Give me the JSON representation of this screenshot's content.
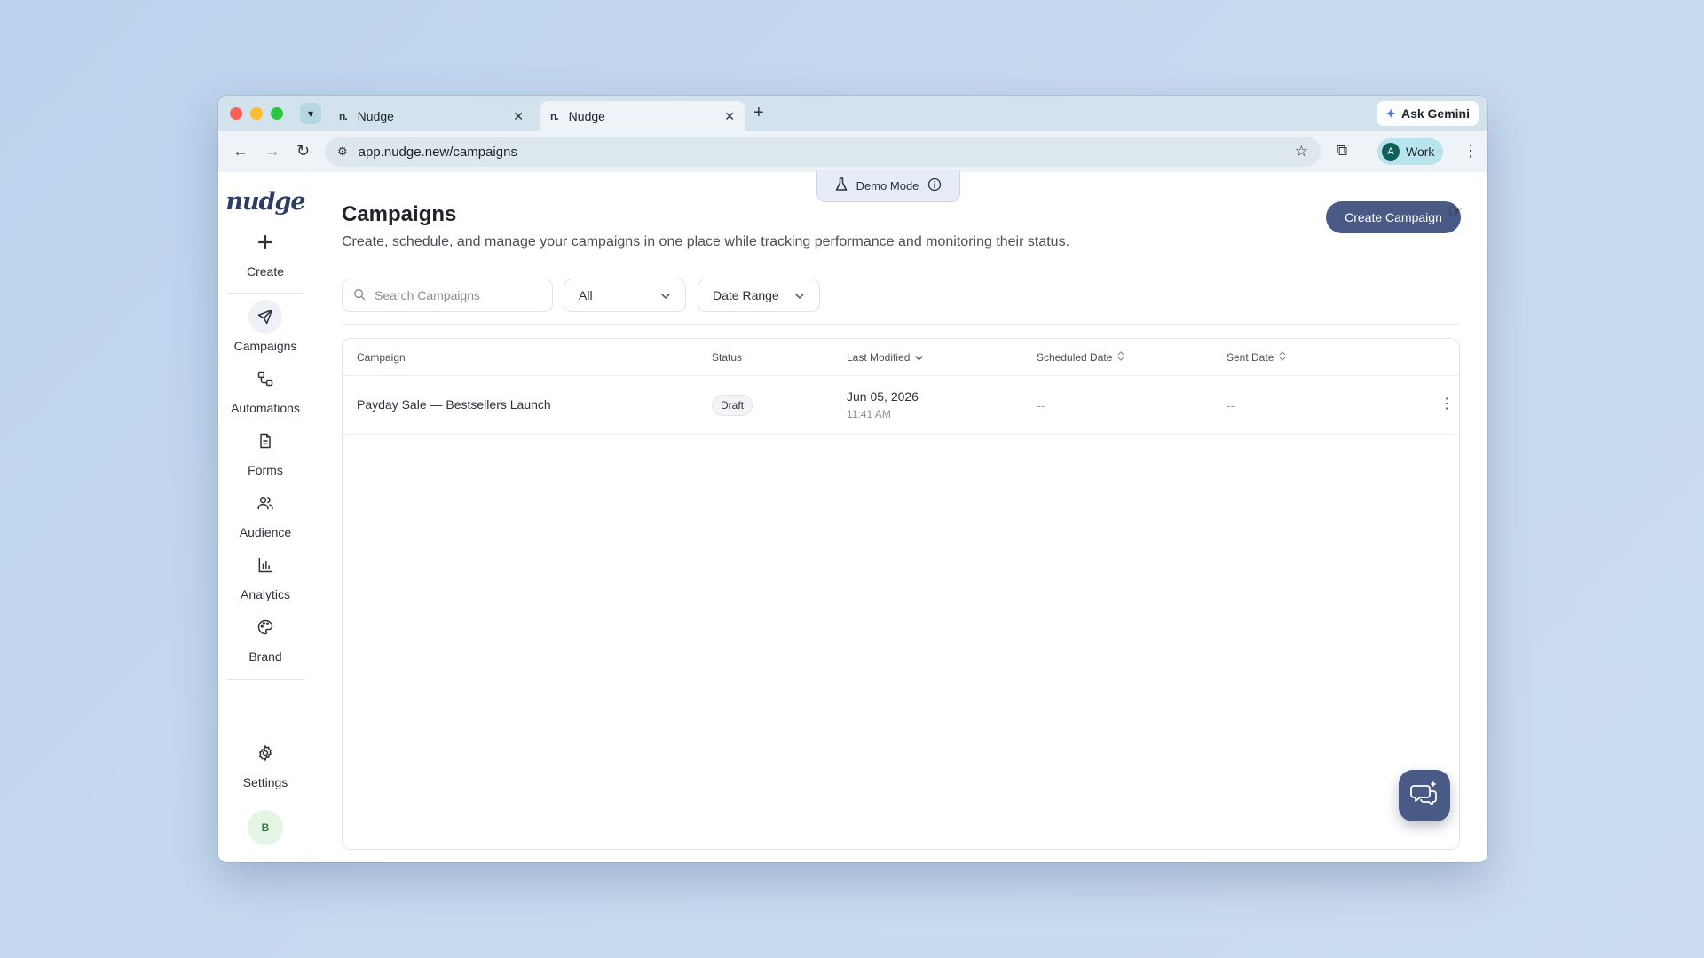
{
  "browser": {
    "tabs": [
      {
        "label": "Nudge",
        "favicon": "n."
      },
      {
        "label": "Nudge",
        "favicon": "n."
      }
    ],
    "url": "app.nudge.new/campaigns",
    "gemini_label": "Ask Gemini",
    "profile_initial": "A",
    "profile_label": "Work"
  },
  "app": {
    "logo": "nudge",
    "demo_mode_label": "Demo Mode",
    "sidebar": {
      "items": [
        {
          "label": "Create",
          "icon": "plus-icon"
        },
        {
          "label": "Campaigns",
          "icon": "paper-plane-icon"
        },
        {
          "label": "Automations",
          "icon": "workflow-icon"
        },
        {
          "label": "Forms",
          "icon": "document-icon"
        },
        {
          "label": "Audience",
          "icon": "users-icon"
        },
        {
          "label": "Analytics",
          "icon": "bar-chart-icon"
        },
        {
          "label": "Brand",
          "icon": "palette-icon"
        },
        {
          "label": "Settings",
          "icon": "gear-icon"
        }
      ],
      "user_initial": "B"
    },
    "page": {
      "title": "Campaigns",
      "subtitle": "Create, schedule, and manage your campaigns in one place while tracking performance and monitoring their status.",
      "create_button": "Create Campaign"
    },
    "filters": {
      "search_placeholder": "Search Campaigns",
      "status_value": "All",
      "date_value": "Date Range"
    },
    "table": {
      "columns": [
        "Campaign",
        "Status",
        "Last Modified",
        "Scheduled Date",
        "Sent Date"
      ],
      "rows": [
        {
          "campaign": "Payday Sale — Bestsellers Launch",
          "status": "Draft",
          "last_modified_date": "Jun 05, 2026",
          "last_modified_time": "11:41 AM",
          "scheduled_date": "--",
          "sent_date": "--"
        }
      ]
    }
  },
  "colors": {
    "accent": "#4a5a86",
    "draft_badge_bg": "#f3f4f6"
  }
}
